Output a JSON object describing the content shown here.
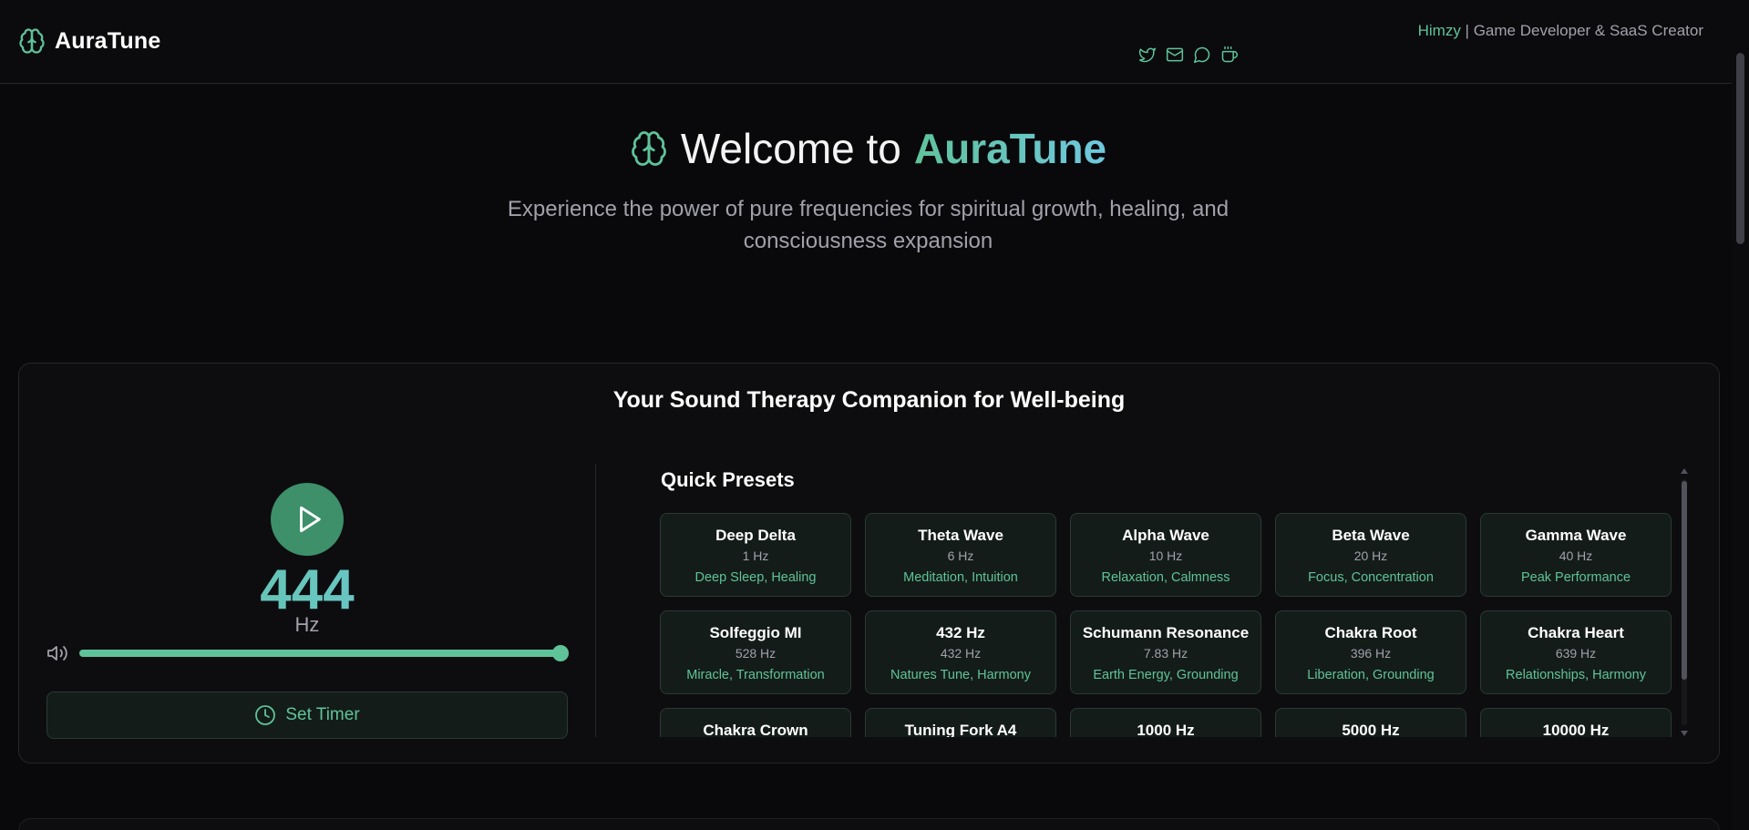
{
  "header": {
    "brand": "AuraTune",
    "author_name": "Himzy",
    "author_separator": " | ",
    "author_role": "Game Developer & SaaS Creator",
    "socials": [
      "twitter-icon",
      "mail-icon",
      "chat-icon",
      "coffee-icon"
    ]
  },
  "hero": {
    "welcome": "Welcome to",
    "brand": "AuraTune",
    "subtitle": "Experience the power of pure frequencies for spiritual growth, healing, and consciousness expansion"
  },
  "card": {
    "title": "Your Sound Therapy Companion for Well-being"
  },
  "player": {
    "frequency": "444",
    "unit": "Hz",
    "volume": 1.0,
    "timer_label": "Set Timer"
  },
  "presets": {
    "title": "Quick Presets",
    "items": [
      {
        "name": "Deep Delta",
        "hz": "1 Hz",
        "desc": "Deep Sleep, Healing"
      },
      {
        "name": "Theta Wave",
        "hz": "6 Hz",
        "desc": "Meditation, Intuition"
      },
      {
        "name": "Alpha Wave",
        "hz": "10 Hz",
        "desc": "Relaxation, Calmness"
      },
      {
        "name": "Beta Wave",
        "hz": "20 Hz",
        "desc": "Focus, Concentration"
      },
      {
        "name": "Gamma Wave",
        "hz": "40 Hz",
        "desc": "Peak Performance"
      },
      {
        "name": "Solfeggio MI",
        "hz": "528 Hz",
        "desc": "Miracle, Transformation"
      },
      {
        "name": "432 Hz",
        "hz": "432 Hz",
        "desc": "Natures Tune, Harmony"
      },
      {
        "name": "Schumann Resonance",
        "hz": "7.83 Hz",
        "desc": "Earth Energy, Grounding"
      },
      {
        "name": "Chakra Root",
        "hz": "396 Hz",
        "desc": "Liberation, Grounding"
      },
      {
        "name": "Chakra Heart",
        "hz": "639 Hz",
        "desc": "Relationships, Harmony"
      },
      {
        "name": "Chakra Crown",
        "hz": "",
        "desc": ""
      },
      {
        "name": "Tuning Fork A4",
        "hz": "",
        "desc": ""
      },
      {
        "name": "1000 Hz",
        "hz": "",
        "desc": ""
      },
      {
        "name": "5000 Hz",
        "hz": "",
        "desc": ""
      },
      {
        "name": "10000 Hz",
        "hz": "",
        "desc": ""
      }
    ]
  },
  "colors": {
    "accent": "#5fc39a",
    "accent_secondary": "#6fc8e0",
    "play_button": "#3d9069",
    "background": "#09090b"
  }
}
